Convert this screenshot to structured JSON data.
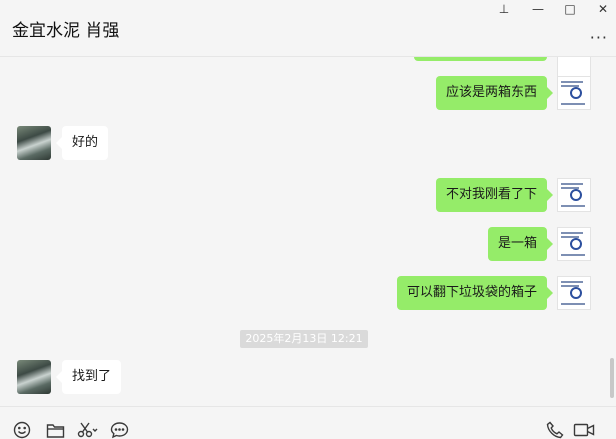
{
  "window": {
    "title": "金宜水泥 肖强",
    "pin_glyph": "⊥",
    "minimize_glyph": "—",
    "maximize_glyph": "□",
    "close_glyph": "✕",
    "more_glyph": "···"
  },
  "messages": [
    {
      "sender": "me",
      "text": "应该是两箱东西"
    },
    {
      "sender": "them",
      "text": "好的"
    },
    {
      "sender": "me",
      "text": "不对我刚看了下"
    },
    {
      "sender": "me",
      "text": "是一箱"
    },
    {
      "sender": "me",
      "text": "可以翻下垃圾袋的箱子"
    },
    {
      "sender": "them",
      "text": "找到了"
    }
  ],
  "timestamp": "2025年2月13日 12:21",
  "toolbar": {
    "left_icons": [
      "emoji-icon",
      "folder-icon",
      "scissors-icon",
      "chat-history-icon"
    ],
    "right_icons": [
      "phone-icon",
      "video-icon"
    ]
  },
  "colors": {
    "my_bubble": "#95ec69",
    "their_bubble": "#ffffff",
    "background": "#f5f5f5"
  }
}
